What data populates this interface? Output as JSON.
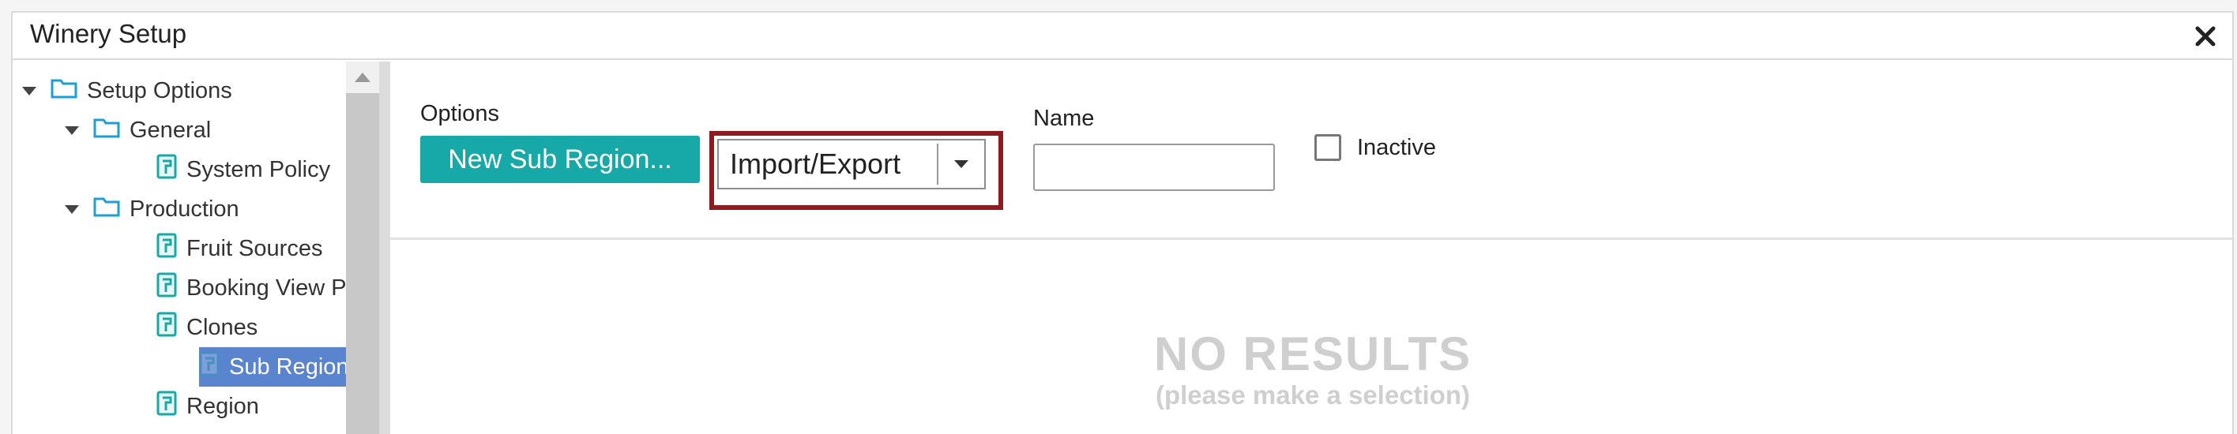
{
  "window": {
    "title": "Winery Setup"
  },
  "tree": {
    "items": [
      {
        "label": "Setup Options",
        "type": "folder",
        "expanded": true,
        "level": 0,
        "selected": false
      },
      {
        "label": "General",
        "type": "folder",
        "expanded": true,
        "level": 1,
        "selected": false
      },
      {
        "label": "System Policy",
        "type": "page",
        "level": 2,
        "selected": false
      },
      {
        "label": "Production",
        "type": "folder",
        "expanded": true,
        "level": 1,
        "selected": false
      },
      {
        "label": "Fruit Sources",
        "type": "page",
        "level": 2,
        "selected": false
      },
      {
        "label": "Booking View P",
        "type": "page",
        "level": 2,
        "selected": false
      },
      {
        "label": "Clones",
        "type": "page",
        "level": 2,
        "selected": false
      },
      {
        "label": "Sub Region",
        "type": "page",
        "level": 2,
        "selected": true
      },
      {
        "label": "Region",
        "type": "page",
        "level": 2,
        "selected": false
      }
    ]
  },
  "toolbar": {
    "options_label": "Options",
    "new_button_label": "New Sub Region...",
    "import_export_value": "Import/Export",
    "name_label": "Name",
    "name_value": "",
    "inactive_label": "Inactive",
    "inactive_checked": false
  },
  "results": {
    "empty_title": "NO RESULTS",
    "empty_subtitle": "(please make a selection)"
  },
  "colors": {
    "accent": "#17a9a8",
    "selection": "#5b84cf",
    "highlight_border": "#8f1b1f",
    "folder_icon": "#1d9fd6",
    "page_icon": "#17a9a8",
    "empty_text": "#cfcfcf"
  },
  "icons": {
    "close": "close-icon",
    "expand": "caret-down-icon",
    "folder": "folder-icon",
    "page": "page-icon",
    "dropdown": "chevron-down-icon"
  }
}
